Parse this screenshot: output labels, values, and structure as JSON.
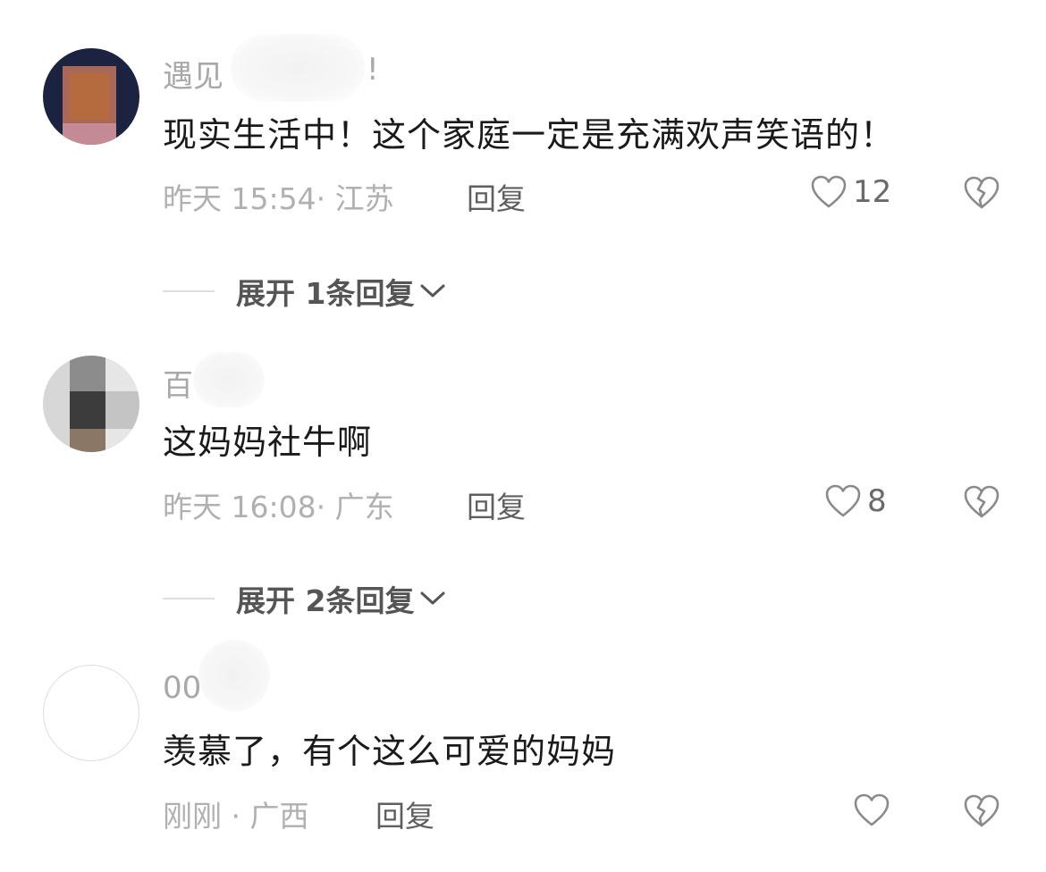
{
  "comments": [
    {
      "username": "遇见",
      "username_tail": "!",
      "text": "现实生活中！这个家庭一定是充满欢声笑语的！",
      "meta": "昨天 15:54· 江苏",
      "reply_label": "回复",
      "likes": "12",
      "expand_label": "展开 1条回复"
    },
    {
      "username": "百",
      "text": "这妈妈社牛啊",
      "meta": "昨天 16:08· 广东",
      "reply_label": "回复",
      "likes": "8",
      "expand_label": "展开 2条回复"
    },
    {
      "username": "00",
      "text": "羡慕了，有个这么可爱的妈妈",
      "meta": "刚刚 · 广西",
      "reply_label": "回复",
      "likes": ""
    }
  ],
  "icons": {
    "like": "heart-outline-icon",
    "dislike": "broken-heart-icon",
    "expand": "chevron-down-icon"
  },
  "colors": {
    "text_primary": "#1a1a1a",
    "text_secondary": "#a8a8a8",
    "reply": "#5f5f5f"
  }
}
